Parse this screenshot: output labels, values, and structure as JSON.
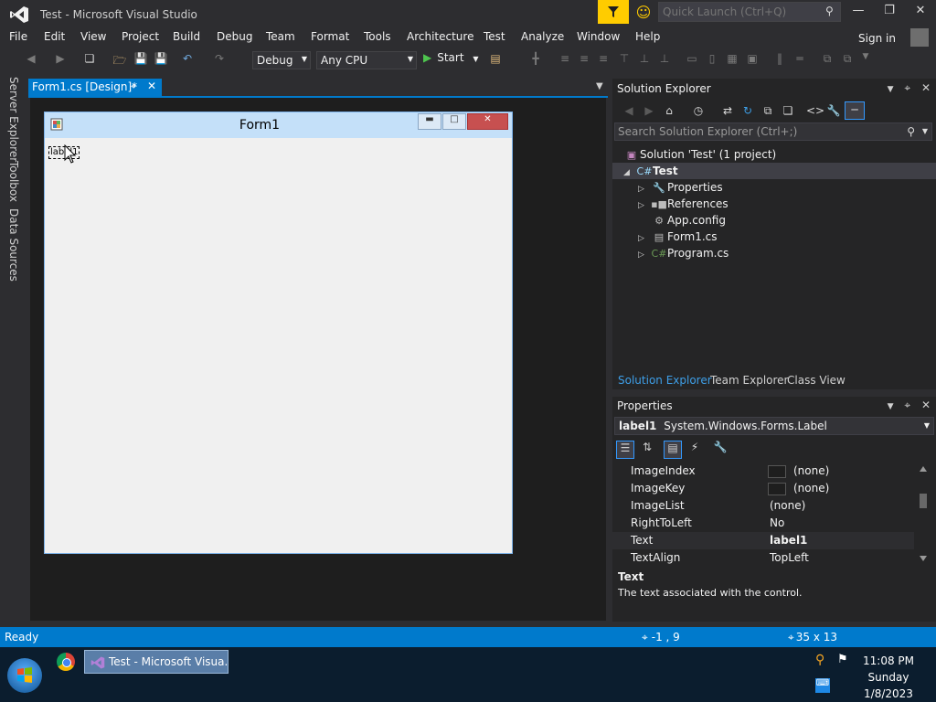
{
  "window": {
    "title": "Test - Microsoft Visual Studio",
    "quick_launch_placeholder": "Quick Launch (Ctrl+Q)"
  },
  "menu": [
    "File",
    "Edit",
    "View",
    "Project",
    "Build",
    "Debug",
    "Team",
    "Format",
    "Tools",
    "Architecture",
    "Test",
    "Analyze",
    "Window",
    "Help"
  ],
  "signin": "Sign in",
  "toolbar": {
    "config": "Debug",
    "platform": "Any CPU",
    "start_label": "Start"
  },
  "side_tabs": [
    "Server Explorer",
    "Toolbox",
    "Data Sources"
  ],
  "document_tab": {
    "label": "Form1.cs [Design]*"
  },
  "form": {
    "title": "Form1",
    "label_control": "label1"
  },
  "solution_explorer": {
    "title": "Solution Explorer",
    "search_placeholder": "Search Solution Explorer (Ctrl+;)",
    "tree": [
      {
        "label": "Solution 'Test' (1 project)",
        "icon": "solution-icon"
      },
      {
        "label": "Test",
        "icon": "csharp-project-icon"
      },
      {
        "label": "Properties",
        "icon": "wrench-icon"
      },
      {
        "label": "References",
        "icon": "references-icon"
      },
      {
        "label": "App.config",
        "icon": "config-icon"
      },
      {
        "label": "Form1.cs",
        "icon": "form-icon"
      },
      {
        "label": "Program.cs",
        "icon": "csharp-file-icon"
      }
    ],
    "tabs": [
      "Solution Explorer",
      "Team Explorer",
      "Class View"
    ]
  },
  "properties": {
    "title": "Properties",
    "object": "label1",
    "object_type": "System.Windows.Forms.Label",
    "rows": [
      {
        "name": "ImageIndex",
        "value": "(none)"
      },
      {
        "name": "ImageKey",
        "value": "(none)"
      },
      {
        "name": "ImageList",
        "value": "(none)"
      },
      {
        "name": "RightToLeft",
        "value": "No"
      },
      {
        "name": "Text",
        "value": "label1"
      },
      {
        "name": "TextAlign",
        "value": "TopLeft"
      }
    ],
    "desc_title": "Text",
    "desc_text": "The text associated with the control."
  },
  "status": {
    "ready": "Ready",
    "position": "-1 , 9",
    "size": "35 x 13"
  },
  "taskbar": {
    "vs_task": "Test - Microsoft Visua...",
    "time": "11:08 PM",
    "day": "Sunday",
    "date": "1/8/2023"
  },
  "colors": {
    "accent": "#007acc",
    "background": "#2d2d30",
    "notification": "#ffcc00"
  }
}
